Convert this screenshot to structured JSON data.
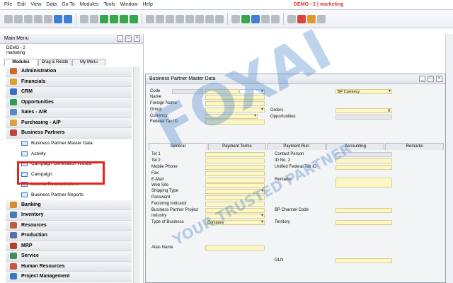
{
  "menubar": {
    "items": [
      "File",
      "Edit",
      "View",
      "Data",
      "Go To",
      "Modules",
      "Tools",
      "Window",
      "Help"
    ],
    "title": "DEMO - 2 | marketing"
  },
  "main_menu": {
    "title": "Main Menu",
    "company_line1": "DEMO - 2",
    "company_line2": "marketing",
    "tabs": [
      "Modules",
      "Drag & Relate",
      "My Menu"
    ],
    "items": [
      {
        "label": "Administration",
        "color": "#d06a2a"
      },
      {
        "label": "Financials",
        "color": "#e0a030"
      },
      {
        "label": "CRM",
        "color": "#3a6fc8"
      },
      {
        "label": "Opportunities",
        "color": "#2f9e5a"
      },
      {
        "label": "Sales - A/R",
        "color": "#5a88c8"
      },
      {
        "label": "Purchasing - A/P",
        "color": "#d9a23a"
      },
      {
        "label": "Business Partners",
        "color": "#c2463e"
      }
    ],
    "sub_items": [
      "Business Partner Master Data",
      "Activity",
      "Campaign Generation Wizard",
      "Campaign",
      "Internal Reconciliations",
      "Business Partner Reports"
    ],
    "items_after": [
      {
        "label": "Banking",
        "color": "#d98a2a"
      },
      {
        "label": "Inventory",
        "color": "#4a78b8"
      },
      {
        "label": "Resources",
        "color": "#c45a3a"
      },
      {
        "label": "Production",
        "color": "#5a6fa8"
      },
      {
        "label": "MRP",
        "color": "#b8402e"
      },
      {
        "label": "Service",
        "color": "#3f8f5a"
      },
      {
        "label": "Human Resources",
        "color": "#c9563a"
      },
      {
        "label": "Project Management",
        "color": "#3a78c2"
      }
    ]
  },
  "bp_window": {
    "title": "Business Partner Master Data",
    "left_labels": [
      "Code",
      "Name",
      "Foreign Name",
      "Group",
      "Currency",
      "Federal Tax ID"
    ],
    "right_labels": {
      "orders": "Orders",
      "opportunities": "Opportunities"
    },
    "bp_currency": "BP Currency",
    "orders_value": "0",
    "tabs": [
      "General",
      "Payment Terms",
      "Payment Run",
      "Accounting",
      "Remarks"
    ],
    "general_left": [
      "Tel 1",
      "Tel 2",
      "Mobile Phone",
      "Fax",
      "E-Mail",
      "Web Site",
      "Shipping Type",
      "Password",
      "Factoring Indicator",
      "Business Partner Project",
      "Industry",
      "Type of Business"
    ],
    "type_of_business_value": "Company",
    "alias_name": "Alias Name",
    "general_right": {
      "contact_person": "Contact Person",
      "id_no2": "ID No. 2",
      "unified_tax": "Unified Federal Tax ID",
      "remarks": "Remarks",
      "bp_channel_code": "BP Channel Code",
      "territory": "Territory",
      "gln": "GLN"
    }
  },
  "watermark": {
    "logo": "FOXAI",
    "tagline": "YOUR TRUSTED PARTNER"
  }
}
